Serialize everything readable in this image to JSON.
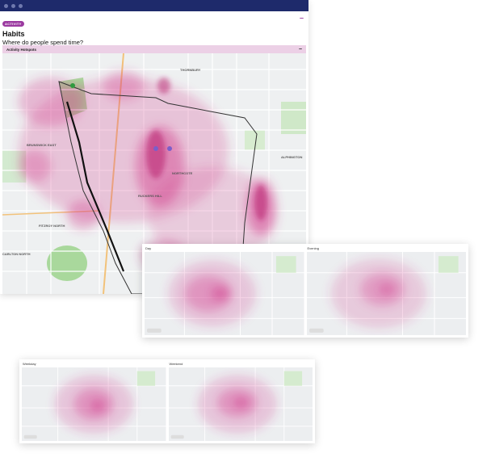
{
  "window": {
    "dots": 3
  },
  "header": {
    "badge": "ACTIVITY",
    "title": "Habits",
    "subtitle": "Where do people spend time?",
    "collapse_icon": "minus-icon"
  },
  "section": {
    "label": "Activity Hotspots",
    "toggle": "−"
  },
  "map_labels": {
    "thornbury": "THORNBURY",
    "northcote": "NORTHCOTE",
    "rucken_hill": "RUCKERS HILL",
    "brunswick_east": "BRUNSWICK EAST",
    "fitzroy_north": "FITZROY NORTH",
    "carlton_north": "CARLTON NORTH",
    "alphington": "ALPHINGTON"
  },
  "panels": {
    "day": "Day",
    "evening": "Evening",
    "weekday": "Weekday",
    "weekend": "Weekend"
  },
  "colors": {
    "titlebar": "#1e2a6b",
    "accent": "#9b3aa0",
    "section_bg": "#ecd0e6",
    "heat": "#d23c8c"
  }
}
